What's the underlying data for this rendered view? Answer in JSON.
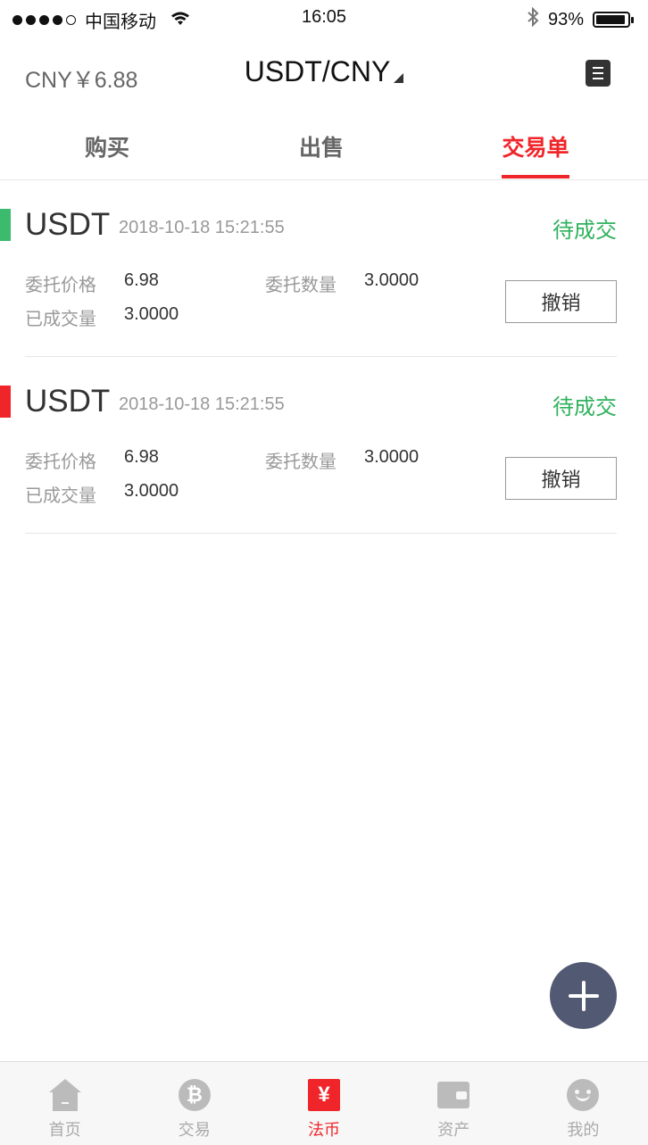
{
  "status_bar": {
    "carrier": "中国移动",
    "time": "16:05",
    "battery": "93%"
  },
  "header": {
    "cny_rate": "CNY￥6.88",
    "pair": "USDT/CNY"
  },
  "tabs": [
    {
      "label": "购买",
      "active": false
    },
    {
      "label": "出售",
      "active": false
    },
    {
      "label": "交易单",
      "active": true
    }
  ],
  "orders": [
    {
      "coin": "USDT",
      "datetime": "2018-10-18 15:21:55",
      "status": "待成交",
      "indicator_color": "#3cba6e",
      "price_label": "委托价格",
      "price": "6.98",
      "qty_label": "委托数量",
      "qty": "3.0000",
      "filled_label": "已成交量",
      "filled": "3.0000",
      "cancel_label": "撤销"
    },
    {
      "coin": "USDT",
      "datetime": "2018-10-18 15:21:55",
      "status": "待成交",
      "indicator_color": "#f0252a",
      "price_label": "委托价格",
      "price": "6.98",
      "qty_label": "委托数量",
      "qty": "3.0000",
      "filled_label": "已成交量",
      "filled": "3.0000",
      "cancel_label": "撤销"
    }
  ],
  "fab": {
    "icon": "plus-icon"
  },
  "bottom_nav": [
    {
      "label": "首页",
      "icon": "home-icon",
      "active": false
    },
    {
      "label": "交易",
      "icon": "bitcoin-icon",
      "active": false
    },
    {
      "label": "法币",
      "icon": "yen-icon",
      "active": true
    },
    {
      "label": "资产",
      "icon": "wallet-icon",
      "active": false
    },
    {
      "label": "我的",
      "icon": "profile-icon",
      "active": false
    }
  ],
  "colors": {
    "accent_red": "#f0252a",
    "status_green": "#2fb25d",
    "text_dark": "#333333",
    "text_gray": "#666666",
    "text_light": "#999999",
    "fab": "#525a73"
  }
}
